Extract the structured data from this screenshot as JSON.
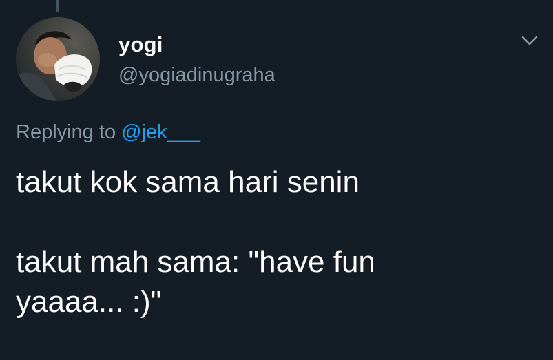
{
  "tweet": {
    "author": {
      "display_name": "yogi",
      "handle": "@yogiadinugraha",
      "avatar_icon": "profile-photo"
    },
    "reply_context": {
      "prefix": "Replying to",
      "mention": "@jek___"
    },
    "text_lines": [
      "takut kok sama hari senin",
      "",
      "takut mah sama: \"have fun",
      "yaaaa... :)\""
    ],
    "menu_icon": "chevron-down-icon"
  },
  "theme": {
    "background": "#141d26",
    "text_primary": "#ffffff",
    "text_secondary": "#8899a6",
    "link": "#1da1f2"
  }
}
